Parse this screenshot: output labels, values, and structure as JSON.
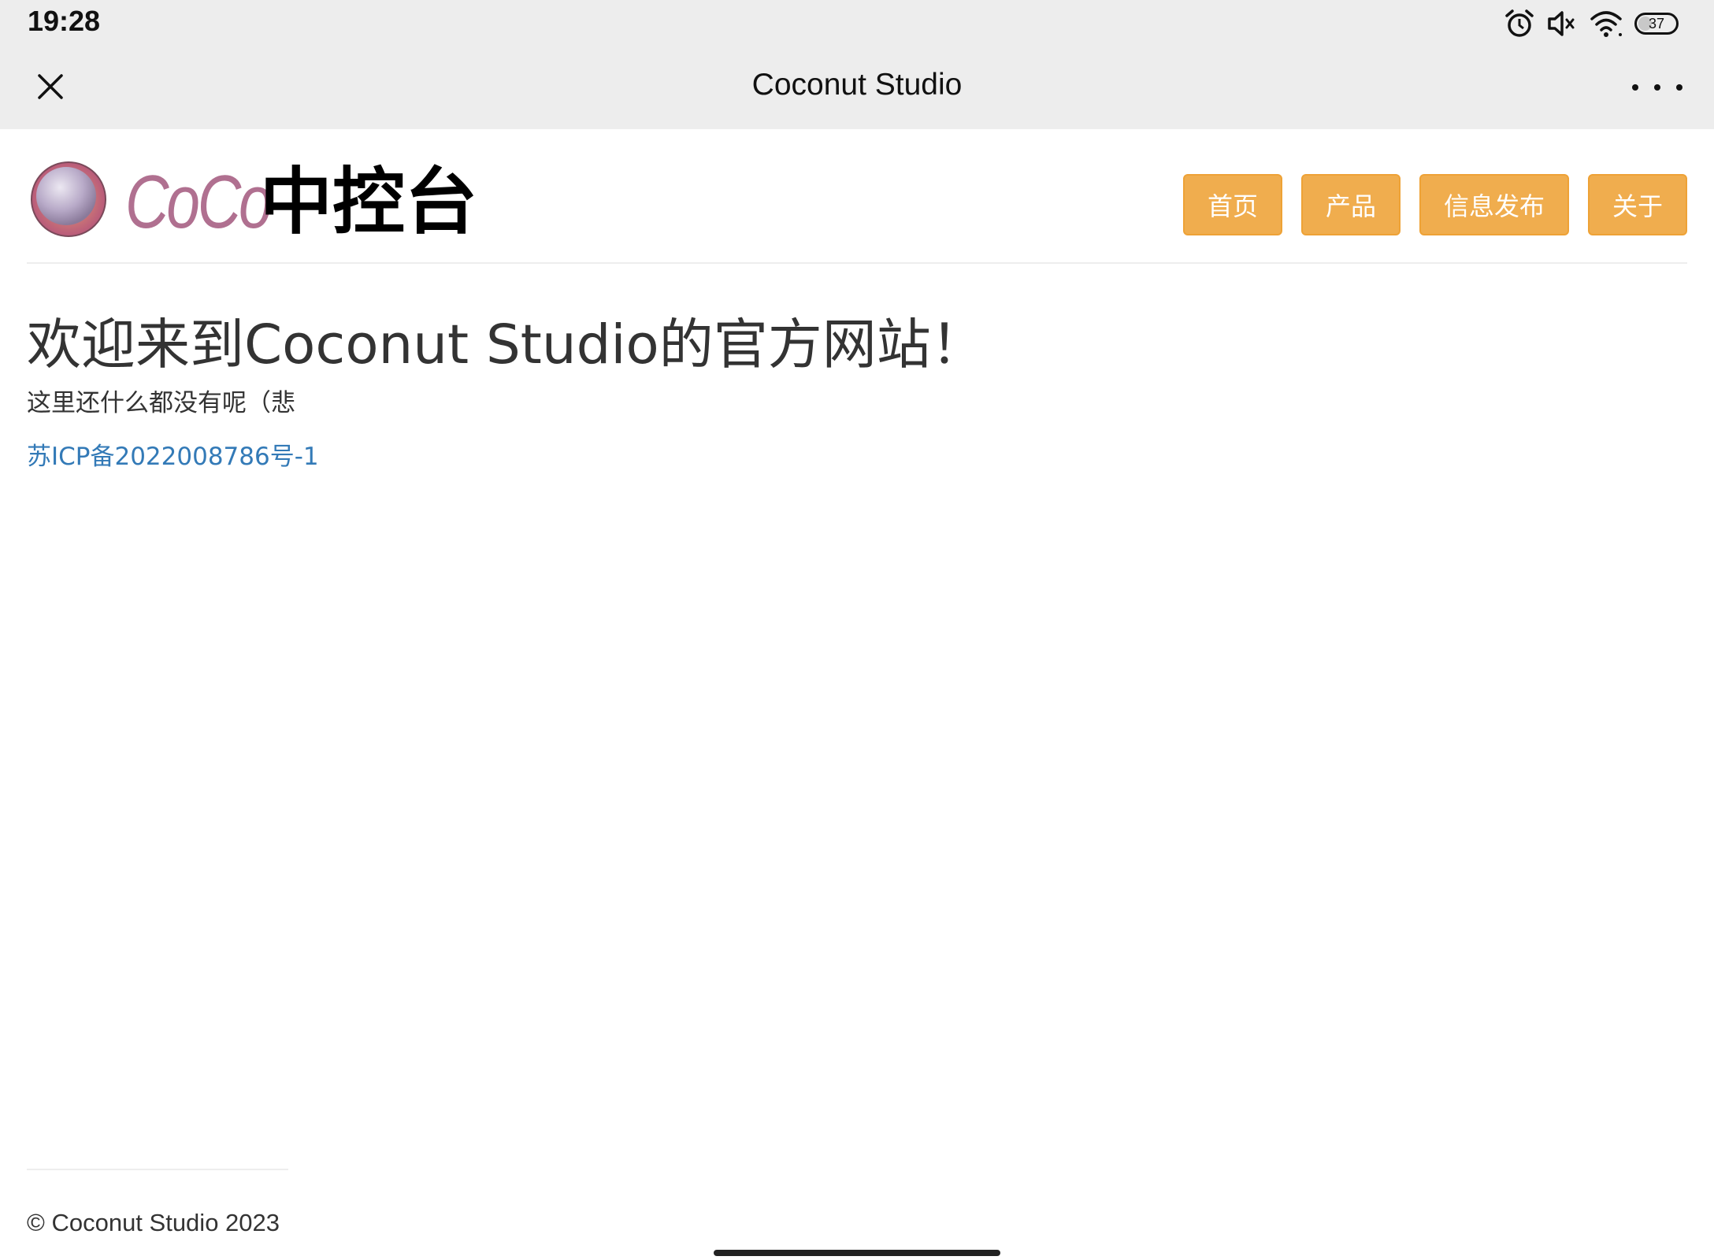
{
  "status_bar": {
    "time": "19:28",
    "battery_level": "37",
    "icons": [
      "alarm-icon",
      "mute-icon",
      "wifi-icon",
      "battery-icon"
    ]
  },
  "title_bar": {
    "title": "Coconut Studio",
    "close_icon": "close-icon",
    "more_icon": "more-icon"
  },
  "site": {
    "brand_latin": "CoCo",
    "brand_chinese": "中控台",
    "nav": [
      {
        "label": "首页"
      },
      {
        "label": "产品"
      },
      {
        "label": "信息发布"
      },
      {
        "label": "关于"
      }
    ],
    "heading": "欢迎来到Coconut Studio的官方网站！",
    "subtitle": "这里还什么都没有呢（悲",
    "icp_link": "苏ICP备2022008786号-1",
    "footer": "© Coconut Studio 2023"
  },
  "colors": {
    "nav_button": "#f0ad4e",
    "link": "#337ab7",
    "bar_background": "#ededed"
  }
}
